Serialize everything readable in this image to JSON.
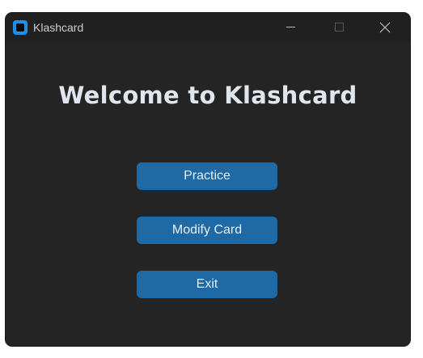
{
  "window": {
    "title": "Klashcard",
    "icon": "app-logo-icon",
    "controls": [
      "minimize-icon",
      "maximize-icon",
      "close-icon"
    ]
  },
  "main": {
    "heading": "Welcome to Klashcard",
    "buttons": {
      "practice": "Practice",
      "modify": "Modify Card",
      "exit": "Exit"
    }
  },
  "colors": {
    "window_bg": "#242424",
    "titlebar_bg": "#202020",
    "button_bg": "#1f6aa5",
    "heading_text": "#dfe6ee",
    "app_icon": "#1e90e8"
  }
}
